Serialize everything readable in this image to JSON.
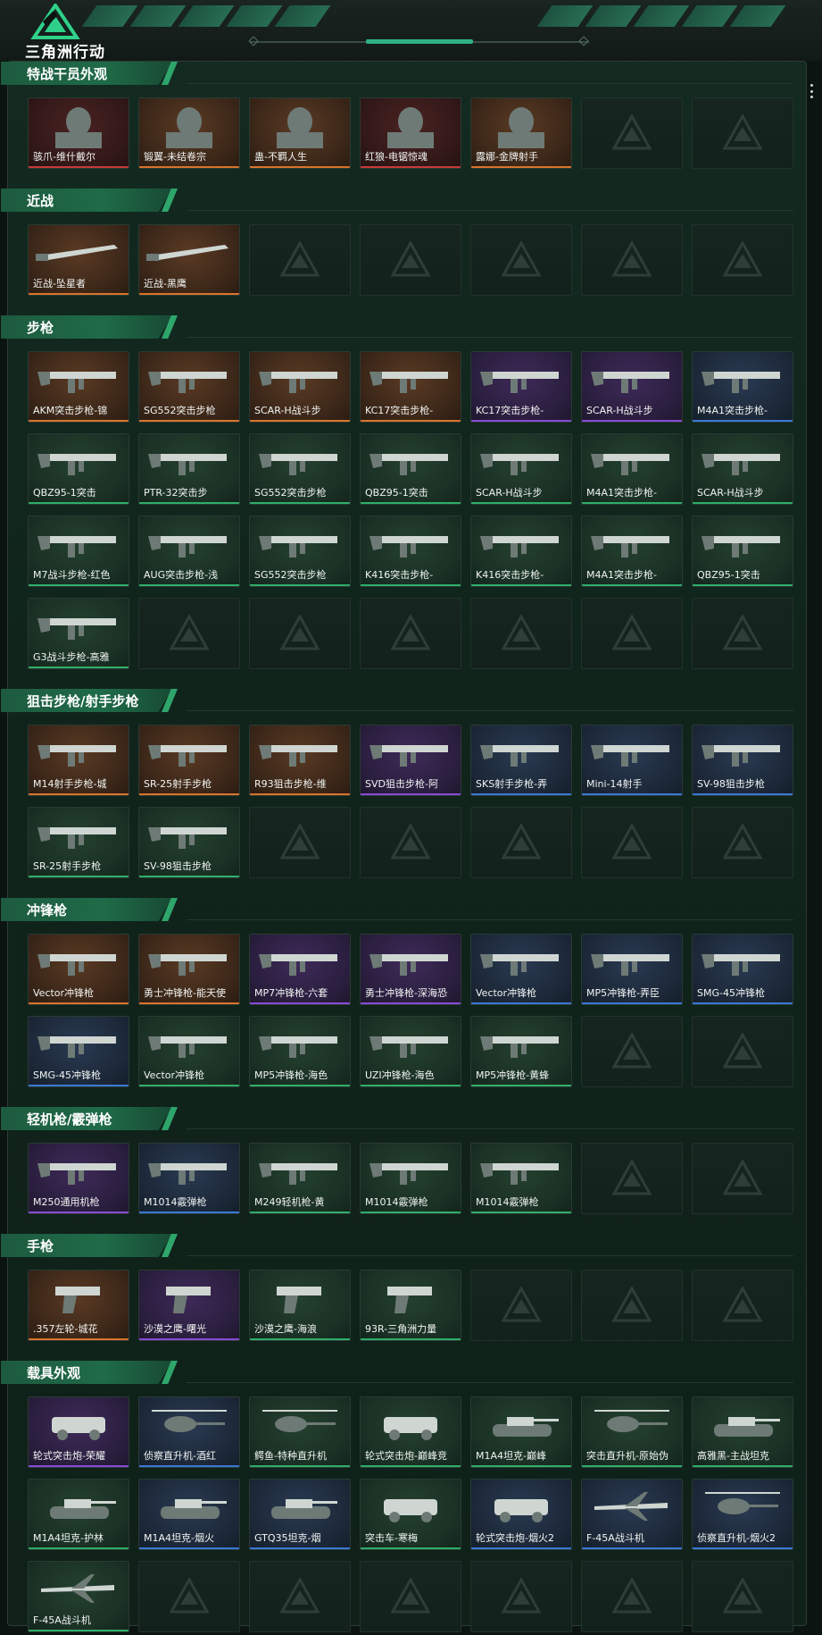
{
  "brand": {
    "name": "三角洲行动"
  },
  "sections": [
    {
      "title": "特战干员外观",
      "items": [
        {
          "label": "骇爪-维什戴尔",
          "rarity": "red",
          "icon": "operator-portrait-icon"
        },
        {
          "label": "锻翼-未结卷宗",
          "rarity": "orange",
          "icon": "operator-portrait-icon"
        },
        {
          "label": "蛊-不羁人生",
          "rarity": "orange",
          "icon": "operator-portrait-icon"
        },
        {
          "label": "红狼-电锯惊魂",
          "rarity": "red",
          "icon": "operator-portrait-icon"
        },
        {
          "label": "露娜-金牌射手",
          "rarity": "orange",
          "icon": "operator-portrait-icon"
        },
        {
          "empty": true
        },
        {
          "empty": true
        }
      ]
    },
    {
      "title": "近战",
      "items": [
        {
          "label": "近战-坠星者",
          "rarity": "orange",
          "icon": "melee-blade-icon"
        },
        {
          "label": "近战-黑鹰",
          "rarity": "orange",
          "icon": "melee-knife-icon"
        },
        {
          "empty": true
        },
        {
          "empty": true
        },
        {
          "empty": true
        },
        {
          "empty": true
        },
        {
          "empty": true
        }
      ]
    },
    {
      "title": "步枪",
      "items": [
        {
          "label": "AKM突击步枪-锦",
          "rarity": "orange",
          "icon": "rifle-icon"
        },
        {
          "label": "SG552突击步枪",
          "rarity": "orange",
          "icon": "rifle-icon"
        },
        {
          "label": "SCAR-H战斗步",
          "rarity": "orange",
          "icon": "rifle-icon"
        },
        {
          "label": "KC17突击步枪-",
          "rarity": "orange",
          "icon": "rifle-icon"
        },
        {
          "label": "KC17突击步枪-",
          "rarity": "purple",
          "icon": "rifle-icon"
        },
        {
          "label": "SCAR-H战斗步",
          "rarity": "purple",
          "icon": "rifle-icon"
        },
        {
          "label": "M4A1突击步枪-",
          "rarity": "blue",
          "icon": "rifle-icon"
        },
        {
          "label": "QBZ95-1突击",
          "rarity": "green",
          "icon": "rifle-icon"
        },
        {
          "label": "PTR-32突击步",
          "rarity": "green",
          "icon": "rifle-icon"
        },
        {
          "label": "SG552突击步枪",
          "rarity": "green",
          "icon": "rifle-icon"
        },
        {
          "label": "QBZ95-1突击",
          "rarity": "green",
          "icon": "rifle-icon"
        },
        {
          "label": "SCAR-H战斗步",
          "rarity": "green",
          "icon": "rifle-icon"
        },
        {
          "label": "M4A1突击步枪-",
          "rarity": "green",
          "icon": "rifle-icon"
        },
        {
          "label": "SCAR-H战斗步",
          "rarity": "green",
          "icon": "rifle-icon"
        },
        {
          "label": "M7战斗步枪-红色",
          "rarity": "green",
          "icon": "rifle-icon"
        },
        {
          "label": "AUG突击步枪-浅",
          "rarity": "green",
          "icon": "rifle-icon"
        },
        {
          "label": "SG552突击步枪",
          "rarity": "green",
          "icon": "rifle-icon"
        },
        {
          "label": "K416突击步枪-",
          "rarity": "green",
          "icon": "rifle-icon"
        },
        {
          "label": "K416突击步枪-",
          "rarity": "green",
          "icon": "rifle-icon"
        },
        {
          "label": "M4A1突击步枪-",
          "rarity": "green",
          "icon": "rifle-icon"
        },
        {
          "label": "QBZ95-1突击",
          "rarity": "green",
          "icon": "rifle-icon"
        },
        {
          "label": "G3战斗步枪-高雅",
          "rarity": "green",
          "icon": "rifle-icon"
        },
        {
          "empty": true
        },
        {
          "empty": true
        },
        {
          "empty": true
        },
        {
          "empty": true
        },
        {
          "empty": true
        },
        {
          "empty": true
        }
      ]
    },
    {
      "title": "狙击步枪/射手步枪",
      "items": [
        {
          "label": "M14射手步枪-城",
          "rarity": "orange",
          "icon": "sniper-icon"
        },
        {
          "label": "SR-25射手步枪",
          "rarity": "orange",
          "icon": "sniper-icon"
        },
        {
          "label": "R93狙击步枪-维",
          "rarity": "orange",
          "icon": "sniper-icon"
        },
        {
          "label": "SVD狙击步枪-阿",
          "rarity": "purple",
          "icon": "sniper-icon"
        },
        {
          "label": "SKS射手步枪-弄",
          "rarity": "blue",
          "icon": "sniper-icon"
        },
        {
          "label": "Mini-14射手",
          "rarity": "blue",
          "icon": "sniper-icon"
        },
        {
          "label": "SV-98狙击步枪",
          "rarity": "blue",
          "icon": "sniper-icon"
        },
        {
          "label": "SR-25射手步枪",
          "rarity": "green",
          "icon": "sniper-icon"
        },
        {
          "label": "SV-98狙击步枪",
          "rarity": "green",
          "icon": "sniper-icon"
        },
        {
          "empty": true
        },
        {
          "empty": true
        },
        {
          "empty": true
        },
        {
          "empty": true
        },
        {
          "empty": true
        }
      ]
    },
    {
      "title": "冲锋枪",
      "items": [
        {
          "label": "Vector冲锋枪",
          "rarity": "orange",
          "icon": "smg-icon"
        },
        {
          "label": "勇士冲锋枪-能天使",
          "rarity": "orange",
          "icon": "smg-icon"
        },
        {
          "label": "MP7冲锋枪-六套",
          "rarity": "purple",
          "icon": "smg-icon"
        },
        {
          "label": "勇士冲锋枪-深海恐",
          "rarity": "purple",
          "icon": "smg-icon"
        },
        {
          "label": "Vector冲锋枪",
          "rarity": "blue",
          "icon": "smg-icon"
        },
        {
          "label": "MP5冲锋枪-弄臣",
          "rarity": "blue",
          "icon": "smg-icon"
        },
        {
          "label": "SMG-45冲锋枪",
          "rarity": "blue",
          "icon": "smg-icon"
        },
        {
          "label": "SMG-45冲锋枪",
          "rarity": "blue",
          "icon": "smg-icon"
        },
        {
          "label": "Vector冲锋枪",
          "rarity": "green",
          "icon": "smg-icon"
        },
        {
          "label": "MP5冲锋枪-海色",
          "rarity": "green",
          "icon": "smg-icon"
        },
        {
          "label": "UZI冲锋枪-海色",
          "rarity": "green",
          "icon": "smg-icon"
        },
        {
          "label": "MP5冲锋枪-黄蜂",
          "rarity": "green",
          "icon": "smg-icon"
        },
        {
          "empty": true
        },
        {
          "empty": true
        }
      ]
    },
    {
      "title": "轻机枪/霰弹枪",
      "items": [
        {
          "label": "M250通用机枪",
          "rarity": "purple",
          "icon": "lmg-icon"
        },
        {
          "label": "M1014霰弹枪",
          "rarity": "blue",
          "icon": "shotgun-icon"
        },
        {
          "label": "M249轻机枪-黄",
          "rarity": "green",
          "icon": "lmg-icon"
        },
        {
          "label": "M1014霰弹枪",
          "rarity": "green",
          "icon": "shotgun-icon"
        },
        {
          "label": "M1014霰弹枪",
          "rarity": "green",
          "icon": "shotgun-icon"
        },
        {
          "empty": true
        },
        {
          "empty": true
        }
      ]
    },
    {
      "title": "手枪",
      "items": [
        {
          "label": ".357左轮-城花",
          "rarity": "orange",
          "icon": "pistol-icon"
        },
        {
          "label": "沙漠之鹰-曙光",
          "rarity": "purple",
          "icon": "pistol-icon"
        },
        {
          "label": "沙漠之鹰-海浪",
          "rarity": "green",
          "icon": "pistol-icon"
        },
        {
          "label": "93R-三角洲力量",
          "rarity": "green",
          "icon": "pistol-icon"
        },
        {
          "empty": true
        },
        {
          "empty": true
        },
        {
          "empty": true
        }
      ]
    },
    {
      "title": "载具外观",
      "items": [
        {
          "label": "轮式突击炮-荣耀",
          "rarity": "purple",
          "icon": "vehicle-icon"
        },
        {
          "label": "侦察直升机-酒红",
          "rarity": "blue",
          "icon": "helicopter-icon"
        },
        {
          "label": "鳄鱼-特种直升机",
          "rarity": "green",
          "icon": "helicopter-icon"
        },
        {
          "label": "轮式突击炮-巅峰竞",
          "rarity": "green",
          "icon": "vehicle-icon"
        },
        {
          "label": "M1A4坦克-巅峰",
          "rarity": "green",
          "icon": "tank-icon"
        },
        {
          "label": "突击直升机-原始伪",
          "rarity": "green",
          "icon": "helicopter-icon"
        },
        {
          "label": "高雅黑-主战坦克",
          "rarity": "green",
          "icon": "tank-icon"
        },
        {
          "label": "M1A4坦克-护林",
          "rarity": "green",
          "icon": "tank-icon"
        },
        {
          "label": "M1A4坦克-烟火",
          "rarity": "blue",
          "icon": "tank-icon"
        },
        {
          "label": "GTQ35坦克-烟",
          "rarity": "blue",
          "icon": "tank-icon"
        },
        {
          "label": "突击车-寒梅",
          "rarity": "green",
          "icon": "vehicle-icon"
        },
        {
          "label": "轮式突击炮-烟火2",
          "rarity": "blue",
          "icon": "vehicle-icon"
        },
        {
          "label": "F-45A战斗机",
          "rarity": "blue",
          "icon": "jet-icon"
        },
        {
          "label": "侦察直升机-烟火2",
          "rarity": "blue",
          "icon": "helicopter-icon"
        },
        {
          "label": "F-45A战斗机",
          "rarity": "green",
          "icon": "jet-icon"
        },
        {
          "empty": true
        },
        {
          "empty": true
        },
        {
          "empty": true
        },
        {
          "empty": true
        },
        {
          "empty": true
        },
        {
          "empty": true
        }
      ]
    }
  ]
}
